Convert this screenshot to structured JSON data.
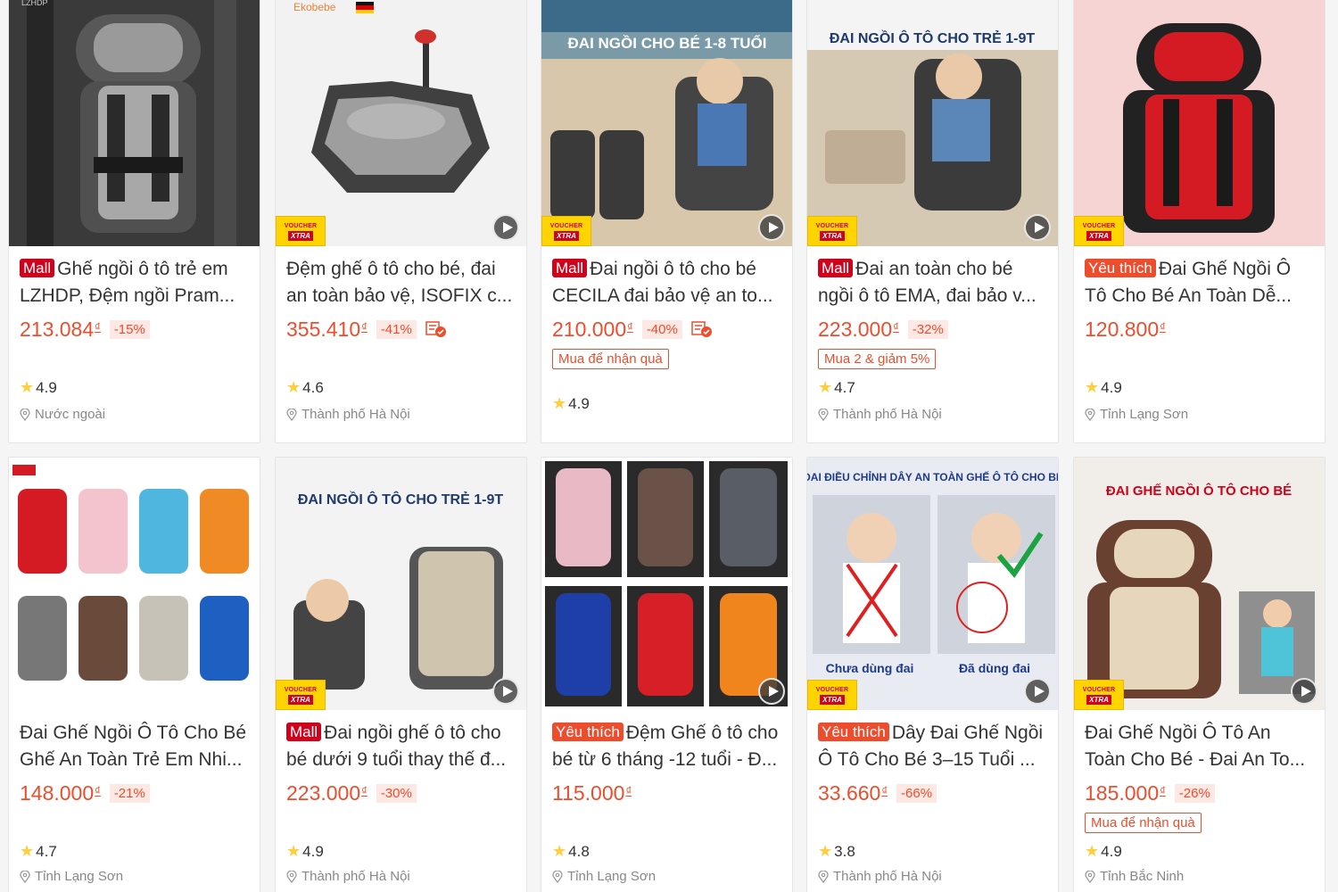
{
  "brand_colors": {
    "accent": "#ee4d2d",
    "mall": "#d0011b",
    "voucher": "#ffd400"
  },
  "products": [
    {
      "badge": "Mall",
      "name": "Ghế ngồi ô tô trẻ em LZHDP, Đệm ngồi Pram...",
      "price": "213.084",
      "currency": "₫",
      "discount": "-15%",
      "rating": "4.9",
      "location": "Nước ngoài",
      "promo": "",
      "voucher": false,
      "video": false,
      "ship_icon": false,
      "image_text": "LZHDP"
    },
    {
      "badge": "",
      "name": "Đệm ghế ô tô cho bé, đai an toàn bảo vệ, ISOFIX c...",
      "price": "355.410",
      "currency": "₫",
      "discount": "-41%",
      "rating": "4.6",
      "location": "Thành phố Hà Nội",
      "promo": "",
      "voucher": true,
      "video": true,
      "ship_icon": true,
      "image_text": "Ekobebe"
    },
    {
      "badge": "Mall",
      "name": "Đai ngồi ô tô cho bé CECILA đai bảo vệ an to...",
      "price": "210.000",
      "currency": "₫",
      "discount": "-40%",
      "rating": "4.9",
      "location": "",
      "promo": "Mua để nhận quà",
      "voucher": true,
      "video": true,
      "ship_icon": true,
      "image_text": "ĐAI NGỒI CHO BÉ 1-8 TUỔI"
    },
    {
      "badge": "Mall",
      "name": "Đai an toàn cho bé ngồi ô tô EMA, đai bảo v...",
      "price": "223.000",
      "currency": "₫",
      "discount": "-32%",
      "rating": "4.7",
      "location": "Thành phố Hà Nội",
      "promo": "Mua 2 & giảm 5%",
      "voucher": true,
      "video": true,
      "ship_icon": false,
      "image_text": "ĐAI NGỒI Ô TÔ CHO TRẺ 1-9T"
    },
    {
      "badge": "Yêu thích",
      "name": "Đai Ghế Ngồi Ô Tô Cho Bé An Toàn Dễ...",
      "price": "120.800",
      "currency": "₫",
      "discount": "",
      "rating": "4.9",
      "location": "Tỉnh Lạng Sơn",
      "promo": "",
      "voucher": true,
      "video": false,
      "ship_icon": false,
      "image_text": ""
    },
    {
      "badge": "",
      "name": "Đai Ghế Ngồi Ô Tô Cho Bé Ghế An Toàn Trẻ Em Nhi...",
      "price": "148.000",
      "currency": "₫",
      "discount": "-21%",
      "rating": "4.7",
      "location": "Tỉnh Lạng Sơn",
      "promo": "",
      "voucher": false,
      "video": false,
      "ship_icon": false,
      "image_text": ""
    },
    {
      "badge": "Mall",
      "name": "Đai ngồi ghế ô tô cho bé dưới 9 tuổi thay thế đ...",
      "price": "223.000",
      "currency": "₫",
      "discount": "-30%",
      "rating": "4.9",
      "location": "Thành phố Hà Nội",
      "promo": "",
      "voucher": true,
      "video": true,
      "ship_icon": false,
      "image_text": "ĐAI NGỒI Ô TÔ CHO TRẺ 1-9T"
    },
    {
      "badge": "Yêu thích",
      "name": "Đệm Ghế ô tô cho bé từ 6 tháng -12 tuổi - Đ...",
      "price": "115.000",
      "currency": "₫",
      "discount": "",
      "rating": "4.8",
      "location": "Tỉnh Lạng Sơn",
      "promo": "",
      "voucher": false,
      "video": true,
      "ship_icon": false,
      "image_text": ""
    },
    {
      "badge": "Yêu thích",
      "name": "Dây Đai Ghế Ngồi Ô Tô Cho Bé 3–15 Tuổi ...",
      "price": "33.660",
      "currency": "₫",
      "discount": "-66%",
      "rating": "3.8",
      "location": "Thành phố Hà Nội",
      "promo": "",
      "voucher": true,
      "video": true,
      "ship_icon": false,
      "image_text": "ĐAI ĐIỀU CHỈNH DÂY AN TOÀN GHẾ Ô TÔ CHO BÉ",
      "image_sub": [
        "Chưa dùng đai",
        "Đã dùng đai"
      ]
    },
    {
      "badge": "",
      "name": "Đai Ghế Ngồi Ô Tô An Toàn Cho Bé - Đai An To...",
      "price": "185.000",
      "currency": "₫",
      "discount": "-26%",
      "rating": "4.9",
      "location": "Tỉnh Bắc Ninh",
      "promo": "Mua để nhận quà",
      "voucher": true,
      "video": true,
      "ship_icon": false,
      "image_text": "ĐAI GHẾ NGỒI Ô TÔ CHO BÉ"
    }
  ],
  "voucher_label": {
    "top": "VOUCHER",
    "bottom": "XTRA"
  }
}
